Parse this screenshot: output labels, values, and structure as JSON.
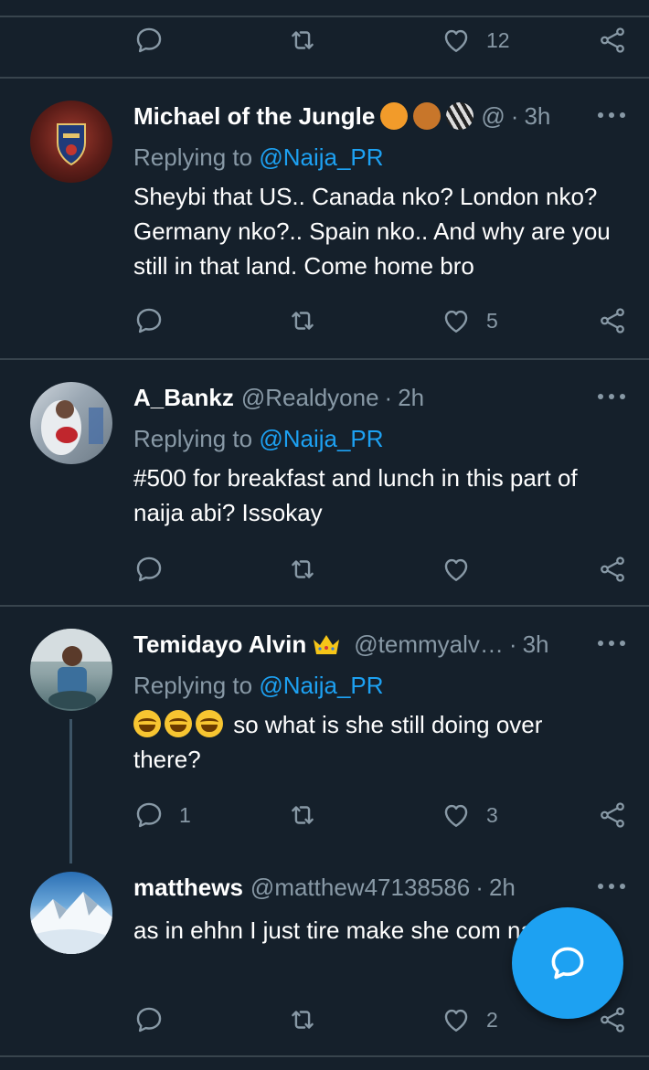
{
  "top_actions": {
    "reply_count": "",
    "retweet_count": "",
    "like_count": "12"
  },
  "tweets": [
    {
      "name": "Michael of the Jungle",
      "handle": "@",
      "time": "3h",
      "replying_prefix": "Replying to",
      "replying_to": "@Naija_PR",
      "text": "Sheybi that US.. Canada nko? London nko? Germany nko?.. Spain nko.. And why are you still in that land. Come home bro",
      "reply_count": "",
      "retweet_count": "",
      "like_count": "5"
    },
    {
      "name": "A_Bankz",
      "handle": "@Realdyone",
      "time": "2h",
      "replying_prefix": "Replying to",
      "replying_to": "@Naija_PR",
      "text": "#500 for breakfast and lunch in this part of naija abi? Issokay",
      "reply_count": "",
      "retweet_count": "",
      "like_count": ""
    },
    {
      "name": "Temidayo Alvin",
      "handle": "@temmyalv…",
      "time": "3h",
      "replying_prefix": "Replying to",
      "replying_to": "@Naija_PR",
      "text": "so what is she still doing over there?",
      "reply_count": "1",
      "retweet_count": "",
      "like_count": "3"
    },
    {
      "name": "matthews",
      "handle": "@matthew47138586",
      "time": "2h",
      "text": "as in ehhn I just tire make she com naw",
      "reply_count": "",
      "retweet_count": "",
      "like_count": "2"
    }
  ],
  "separator": "·",
  "icons": {
    "reply": "reply-icon",
    "retweet": "retweet-icon",
    "like": "heart-icon",
    "share": "share-icon",
    "more": "more-icon",
    "compose": "compose-reply-icon"
  },
  "colors": {
    "background": "#15202b",
    "accent": "#1da1f2",
    "muted": "#8899a6",
    "divider": "#38444d"
  }
}
